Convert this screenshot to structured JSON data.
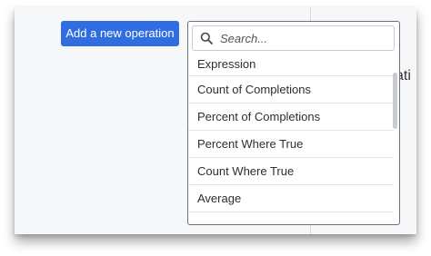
{
  "toolbar": {
    "add_label": "Add a new operation"
  },
  "background": {
    "partial_text": "ati"
  },
  "dropdown": {
    "search_placeholder": "Search...",
    "options": [
      {
        "label": "Expression"
      },
      {
        "label": "Count of Completions"
      },
      {
        "label": "Percent of Completions"
      },
      {
        "label": "Percent Where True"
      },
      {
        "label": "Count Where True"
      },
      {
        "label": "Average"
      }
    ]
  }
}
